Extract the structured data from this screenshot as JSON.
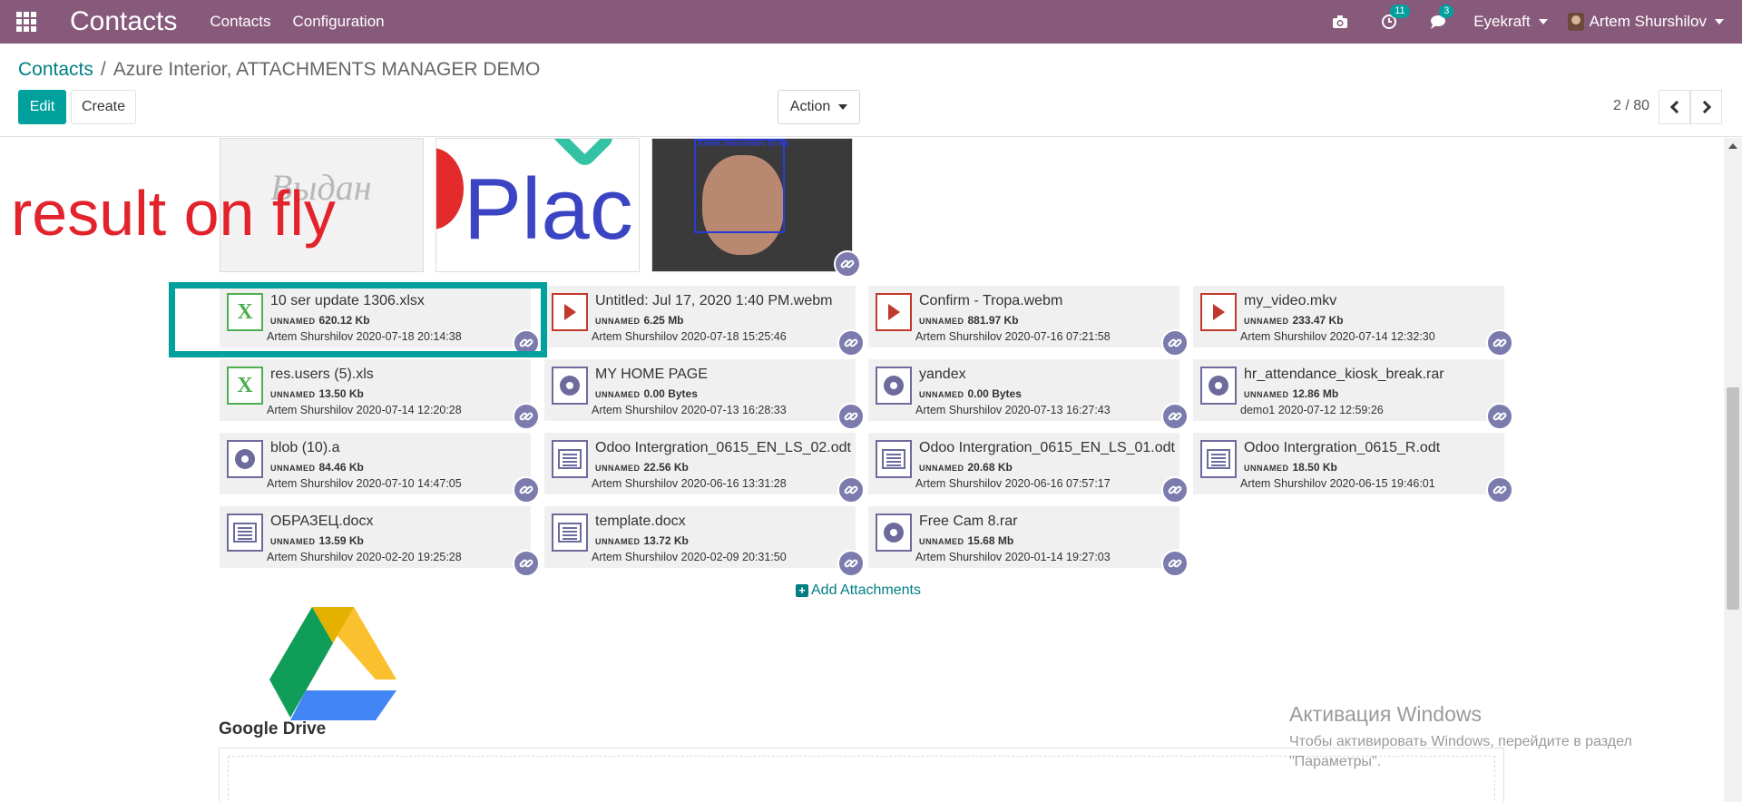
{
  "navbar": {
    "brand": "Contacts",
    "menu": [
      "Contacts",
      "Configuration"
    ],
    "activity_count": "11",
    "message_count": "3",
    "company": "Eyekraft",
    "user": "Artem Shurshilov"
  },
  "control_panel": {
    "breadcrumb_root": "Contacts",
    "breadcrumb_sep": "/",
    "breadcrumb_current": "Azure Interior, ATTACHMENTS MANAGER DEMO",
    "edit_label": "Edit",
    "create_label": "Create",
    "action_label": "Action",
    "pager": "2 / 80"
  },
  "annotation": "result on fly",
  "previews": {
    "preview1_text": "Выдан",
    "preview2_text": "Plac",
    "preview3_caption": "Artem Shurshilov (0.44)"
  },
  "tag_label": "UNNAMED",
  "attachments": [
    {
      "icon": "excel-icon",
      "name": "10 ser update 1306.xlsx",
      "size": "620.12 Kb",
      "user": "Artem Shurshilov 2020-07-18 20:14:38"
    },
    {
      "icon": "video-icon",
      "name": "Untitled: Jul 17, 2020 1:40 PM.webm",
      "size": "6.25 Mb",
      "user": "Artem Shurshilov 2020-07-18 15:25:46"
    },
    {
      "icon": "video-icon",
      "name": "Confirm - Tropa.webm",
      "size": "881.97 Kb",
      "user": "Artem Shurshilov 2020-07-16 07:21:58"
    },
    {
      "icon": "video-icon",
      "name": "my_video.mkv",
      "size": "233.47 Kb",
      "user": "Artem Shurshilov 2020-07-14 12:32:30"
    },
    {
      "icon": "excel-icon",
      "name": "res.users (5).xls",
      "size": "13.50 Kb",
      "user": "Artem Shurshilov 2020-07-14 12:20:28"
    },
    {
      "icon": "gear-icon",
      "name": "MY HOME PAGE",
      "size": "0.00 Bytes",
      "user": "Artem Shurshilov 2020-07-13 16:28:33"
    },
    {
      "icon": "gear-icon",
      "name": "yandex",
      "size": "0.00 Bytes",
      "user": "Artem Shurshilov 2020-07-13 16:27:43"
    },
    {
      "icon": "gear-icon",
      "name": "hr_attendance_kiosk_break.rar",
      "size": "12.86 Mb",
      "user": "demo1 2020-07-12 12:59:26"
    },
    {
      "icon": "gear-icon",
      "name": "blob (10).a",
      "size": "84.46 Kb",
      "user": "Artem Shurshilov 2020-07-10 14:47:05"
    },
    {
      "icon": "document-icon",
      "name": "Odoo Intergration_0615_EN_LS_02.odt",
      "size": "22.56 Kb",
      "user": "Artem Shurshilov 2020-06-16 13:31:28"
    },
    {
      "icon": "document-icon",
      "name": "Odoo Intergration_0615_EN_LS_01.odt",
      "size": "20.68 Kb",
      "user": "Artem Shurshilov 2020-06-16 07:57:17"
    },
    {
      "icon": "document-icon",
      "name": "Odoo Intergration_0615_R.odt",
      "size": "18.50 Kb",
      "user": "Artem Shurshilov 2020-06-15 19:46:01"
    },
    {
      "icon": "document-icon",
      "name": "ОБРАЗЕЦ.docx",
      "size": "13.59 Kb",
      "user": "Artem Shurshilov 2020-02-20 19:25:28"
    },
    {
      "icon": "document-icon",
      "name": "template.docx",
      "size": "13.72 Kb",
      "user": "Artem Shurshilov 2020-02-09 20:31:50"
    },
    {
      "icon": "gear-icon",
      "name": "Free Cam 8.rar",
      "size": "15.68 Mb",
      "user": "Artem Shurshilov 2020-01-14 19:27:03"
    }
  ],
  "add_attachments": "Add Attachments",
  "google_drive": "Google Drive",
  "windows_activation": {
    "title": "Активация Windows",
    "text": "Чтобы активировать Windows, перейдите в раздел \"Параметры\"."
  },
  "colors": {
    "navbar": "#875a7b",
    "primary": "#00a09d",
    "link": "#017e84",
    "annotation": "#e3232b"
  }
}
